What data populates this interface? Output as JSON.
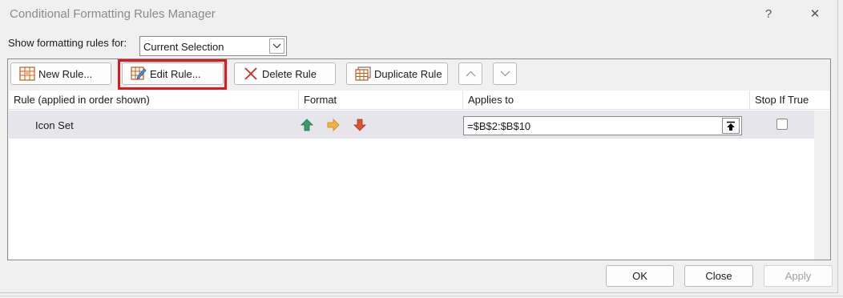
{
  "window": {
    "title": "Conditional Formatting Rules Manager",
    "help": "?",
    "close": "✕"
  },
  "filter": {
    "label": "Show formatting rules for:",
    "selected": "Current Selection"
  },
  "toolbar": {
    "new_rule": "New Rule...",
    "edit_rule": "Edit Rule...",
    "delete_rule": "Delete Rule",
    "duplicate_rule": "Duplicate Rule"
  },
  "table": {
    "headers": [
      "Rule (applied in order shown)",
      "Format",
      "Applies to",
      "Stop If True"
    ],
    "rows": [
      {
        "rule": "Icon Set",
        "format_icons": [
          "green-up-arrow-icon",
          "yellow-right-arrow-icon",
          "red-down-arrow-icon"
        ],
        "applies_to": "=$B$2:$B$10",
        "stop_if_true": false
      }
    ]
  },
  "footer": {
    "ok": "OK",
    "close": "Close",
    "apply": "Apply"
  },
  "colors": {
    "highlight": "#e3161c",
    "up_arrow": "#2e8b57",
    "right_arrow": "#f2a93b",
    "down_arrow": "#d9472b"
  }
}
